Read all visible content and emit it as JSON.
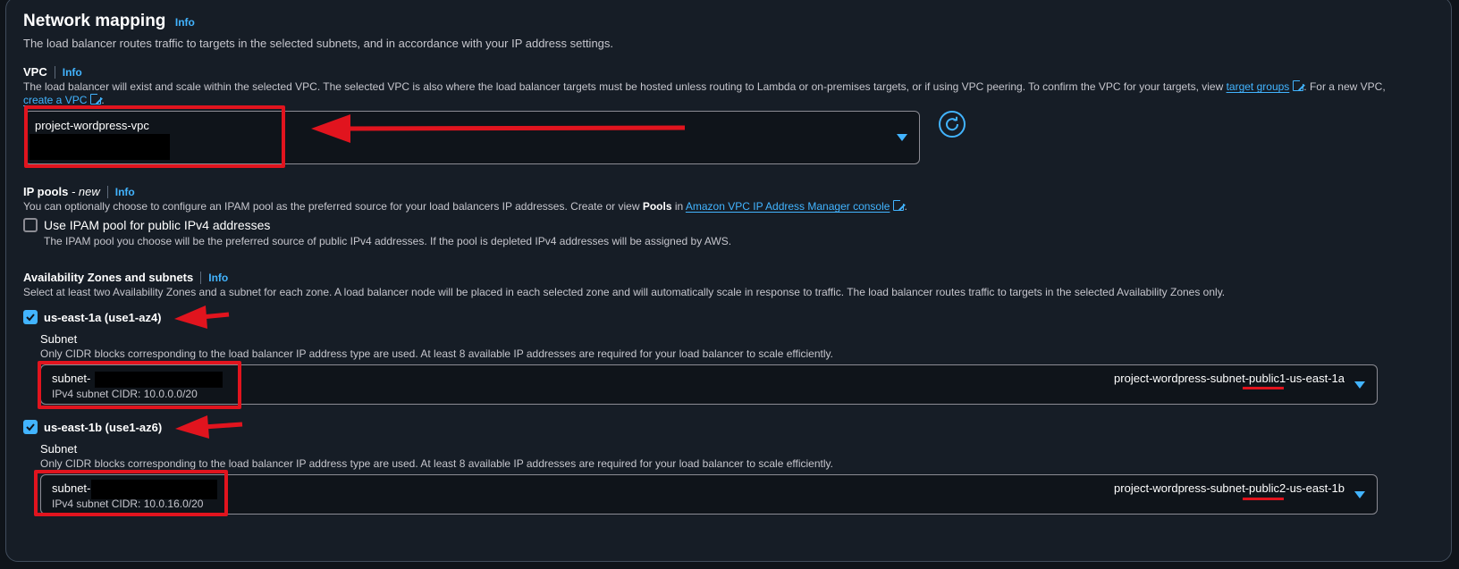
{
  "section": {
    "title": "Network mapping",
    "info": "Info",
    "description": "The load balancer routes traffic to targets in the selected subnets, and in accordance with your IP address settings."
  },
  "vpc": {
    "label": "VPC",
    "info": "Info",
    "desc_part1": "The load balancer will exist and scale within the selected VPC. The selected VPC is also where the load balancer targets must be hosted unless routing to Lambda or on-premises targets, or if using VPC peering. To confirm the VPC for your targets, view ",
    "link_target_groups": "target groups",
    "desc_part2": ". For a new VPC,",
    "link_create_vpc": "create a VPC",
    "desc_part3": ".",
    "selected": "project-wordpress-vpc"
  },
  "ip_pools": {
    "label": "IP pools",
    "label_suffix": " - new",
    "info": "Info",
    "desc_part1": "You can optionally choose to configure an IPAM pool as the preferred source for your load balancers IP addresses. Create or view ",
    "desc_bold": "Pools",
    "desc_part2": " in ",
    "link_ipam": "Amazon VPC IP Address Manager console",
    "desc_part3": ".",
    "checkbox_label": "Use IPAM pool for public IPv4 addresses",
    "checkbox_desc": "The IPAM pool you choose will be the preferred source of public IPv4 addresses. If the pool is depleted IPv4 addresses will be assigned by AWS.",
    "checked": false
  },
  "az": {
    "label": "Availability Zones and subnets",
    "info": "Info",
    "description": "Select at least two Availability Zones and a subnet for each zone. A load balancer node will be placed in each selected zone and will automatically scale in response to traffic. The load balancer routes traffic to targets in the selected Availability Zones only.",
    "zones": [
      {
        "name": "us-east-1a (use1-az4)",
        "checked": true,
        "subnet_label": "Subnet",
        "subnet_desc": "Only CIDR blocks corresponding to the load balancer IP address type are used. At least 8 available IP addresses are required for your load balancer to scale efficiently.",
        "subnet_id_prefix": "subnet-",
        "cidr": "IPv4 subnet CIDR: 10.0.0.0/20",
        "subnet_name": "project-wordpress-subnet-public1-us-east-1a"
      },
      {
        "name": "us-east-1b (use1-az6)",
        "checked": true,
        "subnet_label": "Subnet",
        "subnet_desc": "Only CIDR blocks corresponding to the load balancer IP address type are used. At least 8 available IP addresses are required for your load balancer to scale efficiently.",
        "subnet_id_prefix": "subnet-",
        "cidr": "IPv4 subnet CIDR: 10.0.16.0/20",
        "subnet_name": "project-wordpress-subnet-public2-us-east-1b"
      }
    ]
  },
  "colors": {
    "accent": "#42b4ff",
    "annotation": "#e1141e",
    "background": "#161d26"
  },
  "icons": [
    "refresh-icon",
    "external-link-icon",
    "caret-down-icon",
    "checkmark-icon",
    "annotation-arrow"
  ]
}
